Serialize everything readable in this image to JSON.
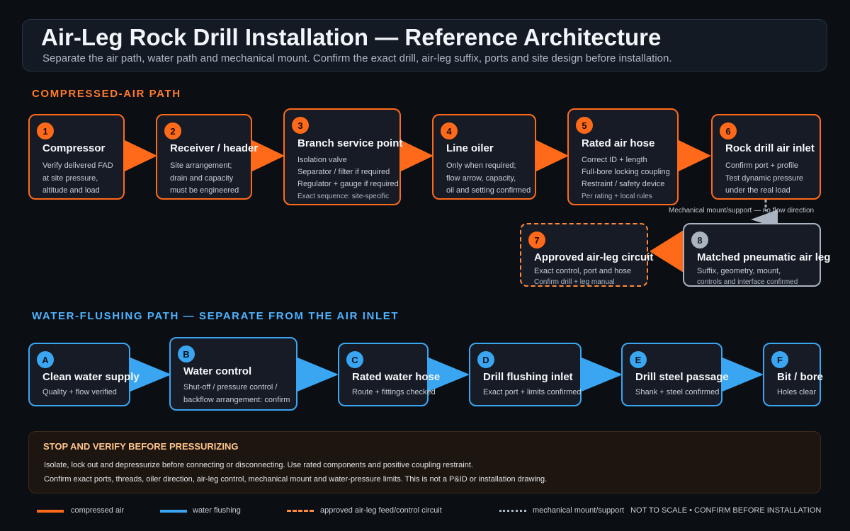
{
  "header": {
    "title": "Air-Leg Rock Drill Installation — Reference Architecture",
    "subtitle": "Separate the air path, water path and mechanical mount. Confirm the exact drill, air-leg suffix, ports and site design before installation."
  },
  "air_section": {
    "label": "COMPRESSED-AIR PATH",
    "nodes": [
      {
        "num": "1",
        "title": "Compressor",
        "lines": [
          "Verify delivered FAD",
          "at site pressure,",
          "altitude and load"
        ]
      },
      {
        "num": "2",
        "title": "Receiver / header",
        "lines": [
          "Site arrangement;",
          "drain and capacity",
          "must be engineered"
        ]
      },
      {
        "num": "3",
        "title": "Branch service point",
        "lines": [
          "Isolation valve",
          "Separator / filter if required",
          "Regulator + gauge if required"
        ],
        "note": "Exact sequence: site-specific"
      },
      {
        "num": "4",
        "title": "Line oiler",
        "lines": [
          "Only when required;",
          "flow arrow, capacity,",
          "oil and setting confirmed"
        ]
      },
      {
        "num": "5",
        "title": "Rated air hose",
        "lines": [
          "Correct ID + length",
          "Full-bore locking coupling",
          "Restraint / safety device"
        ],
        "note": "Per rating + local rules"
      },
      {
        "num": "6",
        "title": "Rock drill air inlet",
        "lines": [
          "Confirm port + profile",
          "Test dynamic pressure",
          "under the real load"
        ]
      },
      {
        "num": "7",
        "title": "Approved air-leg circuit",
        "lines": [
          "Exact control, port and hose"
        ],
        "note": "Confirm drill + leg manual"
      },
      {
        "num": "8",
        "title": "Matched pneumatic air leg",
        "lines": [
          "Suffix, geometry, mount,"
        ],
        "note": "controls and interface confirmed"
      }
    ],
    "mech_label": "Mechanical mount/support — no flow direction"
  },
  "water_section": {
    "label": "WATER-FLUSHING PATH — SEPARATE FROM THE AIR INLET",
    "nodes": [
      {
        "num": "A",
        "title": "Clean water supply",
        "lines": [
          "Quality + flow verified"
        ]
      },
      {
        "num": "B",
        "title": "Water control",
        "lines": [
          "Shut-off / pressure control /",
          "backflow arrangement: confirm"
        ]
      },
      {
        "num": "C",
        "title": "Rated water hose",
        "lines": [
          "Route + fittings checked"
        ]
      },
      {
        "num": "D",
        "title": "Drill flushing inlet",
        "lines": [
          "Exact port + limits confirmed"
        ]
      },
      {
        "num": "E",
        "title": "Drill steel passage",
        "lines": [
          "Shank + steel confirmed"
        ]
      },
      {
        "num": "F",
        "title": "Bit / bore",
        "lines": [
          "Holes clear"
        ]
      }
    ]
  },
  "warning": {
    "title": "STOP AND VERIFY BEFORE PRESSURIZING",
    "lines": [
      "Isolate, lock out and depressurize before connecting or disconnecting. Use rated components and positive coupling restraint.",
      "Confirm exact ports, threads, oiler direction, air-leg control, mechanical mount and water-pressure limits. This is not a P&ID or installation drawing."
    ]
  },
  "legend": {
    "air": "compressed air",
    "water": "water flushing",
    "circuit": "approved air-leg feed/control circuit",
    "mech": "mechanical mount/support",
    "note": "NOT TO SCALE • CONFIRM BEFORE INSTALLATION"
  },
  "colors": {
    "air": "#ff6a1a",
    "water": "#3aa6f2",
    "circuit": "#ff8a3d",
    "mech": "#aab4c0",
    "background": "#0b0e13"
  }
}
